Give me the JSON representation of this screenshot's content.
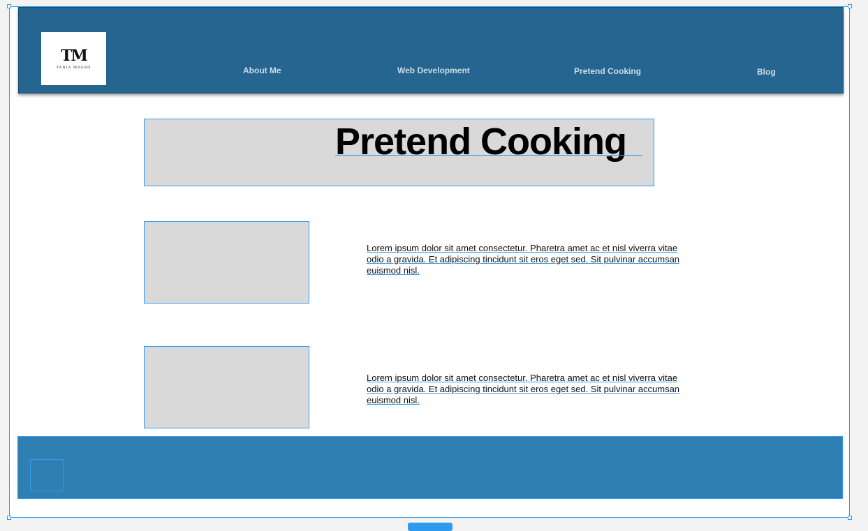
{
  "header": {
    "logo": {
      "monogram": "TM",
      "name": "TANIA MAGRO"
    },
    "nav": [
      {
        "label": "About Me"
      },
      {
        "label": "Web Development"
      },
      {
        "label": "Pretend Cooking"
      },
      {
        "label": "Blog"
      }
    ]
  },
  "main": {
    "title": "Pretend Cooking",
    "rows": [
      {
        "text": "Lorem ipsum dolor sit amet consectetur. Pharetra amet ac et nisl viverra vitae odio a gravida. Et adipiscing tincidunt sit eros eget sed. Sit pulvinar accumsan euismod nisl."
      },
      {
        "text": "Lorem ipsum dolor sit amet consectetur. Pharetra amet ac et nisl viverra vitae odio a gravida. Et adipiscing tincidunt sit eros eget sed. Sit pulvinar accumsan euismod nisl."
      }
    ]
  },
  "colors": {
    "header_bg": "#26658f",
    "footer_bg": "#2f7fb3",
    "placeholder": "#d9d9d9",
    "selection": "#2f9bf0"
  }
}
